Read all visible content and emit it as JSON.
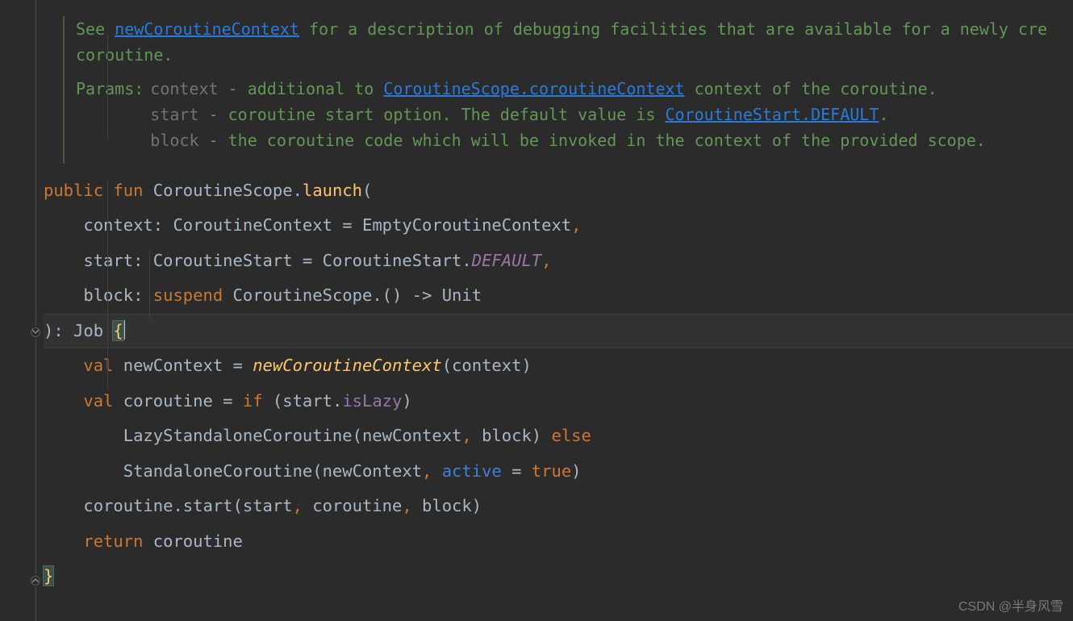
{
  "doc": {
    "see_prefix": "See ",
    "see_link": "newCoroutineContext",
    "see_suffix": " for a description of debugging facilities that are available for a newly cre",
    "see_line2": "coroutine.",
    "params_label": "Params:",
    "param1_name": "context",
    "param1_sep": " - additional to ",
    "param1_link": "CoroutineScope.coroutineContext",
    "param1_tail": " context of the coroutine.",
    "param2_name": "start",
    "param2_pre": " - coroutine start option. The default value is ",
    "param2_link": "CoroutineStart.DEFAULT",
    "param2_tail": ".",
    "param3_name": "block",
    "param3_text": " - the coroutine code which will be invoked in the context of the provided scope."
  },
  "code": {
    "public": "public",
    "fun": "fun",
    "receiver": "CoroutineScope",
    "dot": ".",
    "launch": "launch",
    "lp": "(",
    "p1_name": "context",
    "colon_sp": ": ",
    "p1_type": "CoroutineContext",
    "eq": " = ",
    "p1_default": "EmptyCoroutineContext",
    "comma": ",",
    "p2_name": "start",
    "p2_type": "CoroutineStart",
    "p2_default_cls": "CoroutineStart.",
    "p2_default_const": "DEFAULT",
    "p3_name": "block",
    "suspend": "suspend",
    "p3_type": " CoroutineScope.() -> Unit",
    "rp_ret": "): Job ",
    "lbrace": "{",
    "val": "val",
    "newContext": "newContext",
    "newCoroutineContext": "newCoroutineContext",
    "nc_args": "(context)",
    "coroutine": "coroutine",
    "if": "if",
    "if_cond_pre": " (start.",
    "isLazy": "isLazy",
    "if_cond_post": ")",
    "lazy_call": "LazyStandaloneCoroutine(newContext",
    "block_arg": "block",
    "else": "else",
    "std_call": "StandaloneCoroutine(newContext",
    "active": "active",
    "true": "true",
    "start_call": "coroutine.start(start",
    "start_args_mid": "coroutine",
    "return": "return",
    "ret_val": " coroutine",
    "rbrace": "}"
  },
  "watermark": "CSDN @半身风雪"
}
